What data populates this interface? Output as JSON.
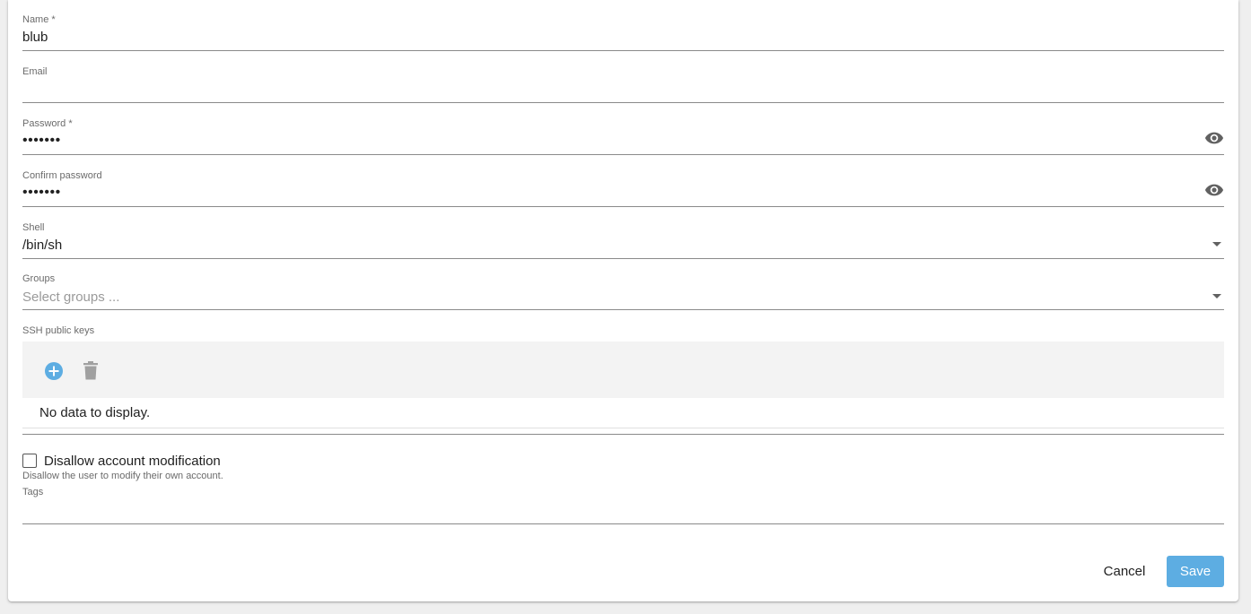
{
  "form": {
    "name": {
      "label": "Name *",
      "value": "blub"
    },
    "email": {
      "label": "Email",
      "value": ""
    },
    "password": {
      "label": "Password *",
      "value": "•••••••"
    },
    "confirm_password": {
      "label": "Confirm password",
      "value": "•••••••"
    },
    "shell": {
      "label": "Shell",
      "value": "/bin/sh"
    },
    "groups": {
      "label": "Groups",
      "placeholder": "Select groups ..."
    },
    "ssh_keys": {
      "label": "SSH public keys",
      "empty_text": "No data to display.",
      "add_icon": "plus-circle-icon",
      "delete_icon": "trash-icon"
    },
    "disallow_modification": {
      "label": "Disallow account modification",
      "hint": "Disallow the user to modify their own account.",
      "checked": false
    },
    "tags": {
      "label": "Tags",
      "value": ""
    }
  },
  "actions": {
    "cancel_label": "Cancel",
    "save_label": "Save"
  },
  "colors": {
    "accent": "#5dade2",
    "toolbar_bg": "#f3f3f3"
  }
}
